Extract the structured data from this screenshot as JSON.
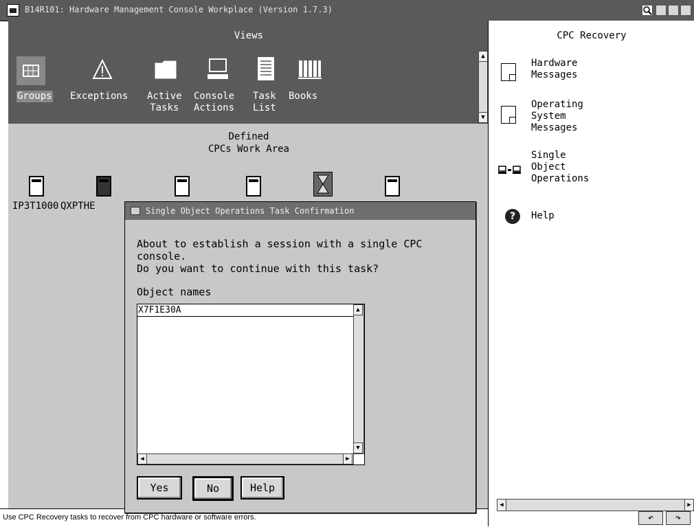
{
  "window": {
    "title": "B14R101: Hardware Management Console Workplace (Version 1.7.3)"
  },
  "views": {
    "title": "Views",
    "items": [
      {
        "label": "Groups",
        "icon": "groups-icon",
        "selected": true
      },
      {
        "label": "Exceptions",
        "icon": "warning-icon"
      },
      {
        "label": "Active\nTasks",
        "icon": "folder-icon"
      },
      {
        "label": "Console\nActions",
        "icon": "console-icon"
      },
      {
        "label": "Task\nList",
        "icon": "tasklist-icon"
      },
      {
        "label": "Books",
        "icon": "books-icon"
      }
    ]
  },
  "work_area": {
    "title": "Defined\nCPCs Work Area",
    "cpcs": [
      {
        "label": "IP3T1000"
      },
      {
        "label": "QXPTHE"
      }
    ]
  },
  "right_panel": {
    "title": "CPC Recovery",
    "tasks": [
      {
        "label": "Hardware\nMessages",
        "icon": "document-icon"
      },
      {
        "label": "Operating\nSystem\nMessages",
        "icon": "document-icon"
      },
      {
        "label": "Single\nObject\nOperations",
        "icon": "computers-icon"
      },
      {
        "label": "Help",
        "icon": "help-icon"
      }
    ]
  },
  "status_bar": {
    "text": "Use CPC Recovery tasks to recover from CPC hardware or software errors."
  },
  "dialog": {
    "title": "Single Object Operations Task Confirmation",
    "message1": "About to establish a session with a single CPC console.",
    "message2": "Do you want to continue with this task?",
    "list_label": "Object names",
    "object_names": [
      "X7F1E30A"
    ],
    "buttons": {
      "yes": "Yes",
      "no": "No",
      "help": "Help"
    }
  }
}
